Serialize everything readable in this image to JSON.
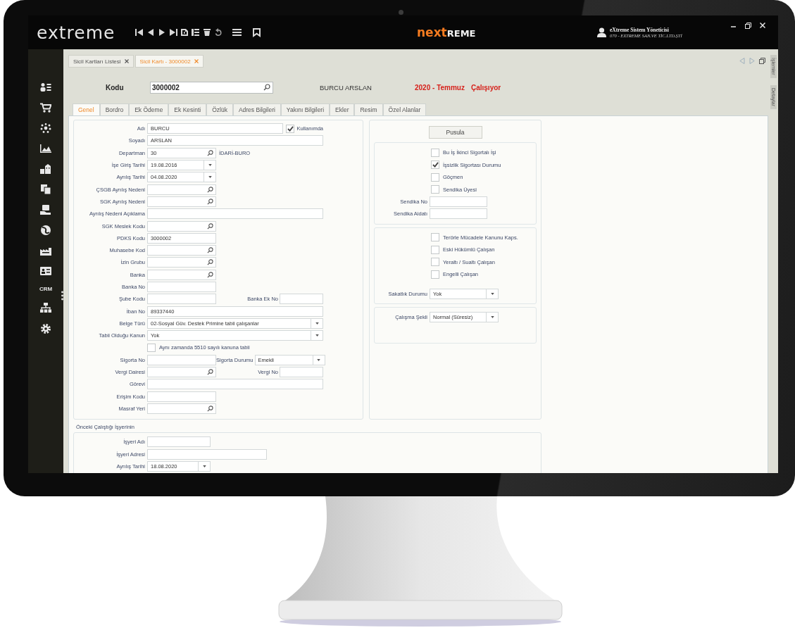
{
  "app_bar": {
    "logo": "extreme",
    "brand": [
      "next",
      "REME"
    ],
    "user": {
      "name": "eXtreme Sistem Yöneticisi",
      "company": "070 - EXTREME SAN.VE TİC.LTD.ŞTİ"
    }
  },
  "sidebar": {
    "crm_label": "CRM"
  },
  "document_tabs": [
    {
      "label": "Sicil Kartları Listesi",
      "selected": false
    },
    {
      "label": "Sicil Kartı - 3000002",
      "selected": true
    }
  ],
  "side_tabs": [
    {
      "label": "İşlemler"
    },
    {
      "label": "Detaylar"
    }
  ],
  "header": {
    "code_label": "Kodu",
    "code_value": "3000002",
    "employee_name": "BURCU ARSLAN",
    "period": "2020 - Temmuz",
    "status": "Çalışıyor"
  },
  "tabs": [
    {
      "label": "Genel",
      "selected": true
    },
    {
      "label": "Bordro",
      "selected": false
    },
    {
      "label": "Ek Ödeme",
      "selected": false
    },
    {
      "label": "Ek Kesinti",
      "selected": false
    },
    {
      "label": "Özlük",
      "selected": false
    },
    {
      "label": "Adres Bilgileri",
      "selected": false
    },
    {
      "label": "Yakını Bilgileri",
      "selected": false
    },
    {
      "label": "Ekler",
      "selected": false
    },
    {
      "label": "Resim",
      "selected": false
    },
    {
      "label": "Özel Alanlar",
      "selected": false
    }
  ],
  "general_form": {
    "rows": [
      {
        "kind": "field",
        "label": "Adı",
        "field": {
          "kind": "text",
          "value": "BURCU",
          "wide": true
        },
        "extra": {
          "kind": "checkbox",
          "label": "Kullanımda",
          "checked": true
        }
      },
      {
        "kind": "field",
        "label": "Soyadı",
        "field": {
          "kind": "text",
          "value": "ARSLAN",
          "wide": true
        }
      },
      {
        "kind": "field",
        "label": "Departman",
        "field": {
          "kind": "lookup",
          "value": "30"
        },
        "extra": {
          "kind": "note",
          "text": "İDARİ-BURO"
        }
      },
      {
        "kind": "field",
        "label": "İşe Giriş Tarihi",
        "field": {
          "kind": "date",
          "value": "19.08.2016"
        }
      },
      {
        "kind": "field",
        "label": "Ayrılış Tarihi",
        "field": {
          "kind": "date",
          "value": "04.08.2020"
        }
      },
      {
        "kind": "field",
        "label": "ÇSGB Ayrılış Nedeni",
        "field": {
          "kind": "lookup"
        }
      },
      {
        "kind": "field",
        "label": "SGK Ayrılış Nedeni",
        "field": {
          "kind": "lookup"
        }
      },
      {
        "kind": "field",
        "label": "Ayrılış Nedeni Açıklama",
        "field": {
          "kind": "text",
          "wide": true
        }
      },
      {
        "kind": "field",
        "label": "SGK Meslek Kodu",
        "field": {
          "kind": "lookup"
        }
      },
      {
        "kind": "field",
        "label": "PDKS Kodu",
        "field": {
          "kind": "text",
          "value": "3000002"
        }
      },
      {
        "kind": "field",
        "label": "Muhasebe Kod",
        "field": {
          "kind": "lookup"
        }
      },
      {
        "kind": "field",
        "label": "İzin Grubu",
        "field": {
          "kind": "lookup"
        }
      },
      {
        "kind": "field",
        "label": "Banka",
        "field": {
          "kind": "lookup"
        }
      },
      {
        "kind": "field",
        "label": "Banka No",
        "field": {
          "kind": "text"
        }
      },
      {
        "kind": "field",
        "label": "Şube Kodu",
        "field": {
          "kind": "text"
        },
        "extra": {
          "kind": "pair",
          "label": "Banka Ek No",
          "field": {
            "kind": "text"
          }
        }
      },
      {
        "kind": "field",
        "label": "İban No",
        "field": {
          "kind": "text",
          "value": "89337440",
          "wide": true
        }
      },
      {
        "kind": "field",
        "label": "Belge Türü",
        "field": {
          "kind": "select",
          "value": "02-Sosyal Güv. Destek Primine tabii çalışanlar",
          "wide": true
        }
      },
      {
        "kind": "field",
        "label": "Tabii Olduğu Kanun",
        "field": {
          "kind": "select",
          "value": "Yok",
          "wide": true
        }
      },
      {
        "kind": "checkbox",
        "label": "Aynı zamanda 5510 sayılı kanuna tabii",
        "checked": false
      },
      {
        "kind": "field",
        "label": "Sigorta No",
        "field": {
          "kind": "text"
        },
        "extra": {
          "kind": "pair",
          "label": "Sigorta Durumu",
          "field": {
            "kind": "select",
            "value": "Emekli"
          }
        }
      },
      {
        "kind": "field",
        "label": "Vergi Dairesi",
        "field": {
          "kind": "lookup"
        },
        "extra": {
          "kind": "pair",
          "label": "Vergi No",
          "field": {
            "kind": "text"
          }
        }
      },
      {
        "kind": "field",
        "label": "Görevi",
        "field": {
          "kind": "text",
          "wide": true
        }
      },
      {
        "kind": "field",
        "label": "Erişim Kodu",
        "field": {
          "kind": "text"
        }
      },
      {
        "kind": "field",
        "label": "Masraf Yeri",
        "field": {
          "kind": "lookup"
        }
      }
    ]
  },
  "right_panel": {
    "button": "Pusula",
    "groups": [
      {
        "rows": [
          {
            "kind": "checkbox",
            "label": "Bu İş İkinci Sigortalı İşi",
            "checked": false
          },
          {
            "kind": "checkbox",
            "label": "İşsizlik Sigortası Durumu",
            "checked": true
          },
          {
            "kind": "checkbox",
            "label": "Göçmen",
            "checked": false
          },
          {
            "kind": "checkbox",
            "label": "Sendika Üyesi",
            "checked": false
          },
          {
            "kind": "field",
            "label": "Sendika No",
            "field": {
              "kind": "text"
            }
          },
          {
            "kind": "field",
            "label": "Sendika Aidatı",
            "field": {
              "kind": "text"
            }
          }
        ]
      },
      {
        "rows": [
          {
            "kind": "checkbox",
            "label": "Terörle Mücadele Kanunu Kaps.",
            "checked": false
          },
          {
            "kind": "checkbox",
            "label": "Eski Hükümlü Çalışan",
            "checked": false
          },
          {
            "kind": "checkbox",
            "label": "Yeraltı / Sualtı Çalışan",
            "checked": false
          },
          {
            "kind": "checkbox",
            "label": "Engelli Çalışan",
            "checked": false
          },
          {
            "kind": "field",
            "label": "Sakatlık Durumu",
            "field": {
              "kind": "select",
              "value": "Yok"
            }
          }
        ]
      },
      {
        "rows": [
          {
            "kind": "field",
            "label": "Çalışma Şekli",
            "field": {
              "kind": "select",
              "value": "Normal (Süresiz)"
            }
          }
        ]
      }
    ]
  },
  "previous_employer": {
    "title": "Önceki Çalıştığı İşyerinin",
    "rows": [
      {
        "kind": "field",
        "label": "İşyeri Adı",
        "field": {
          "kind": "text"
        }
      },
      {
        "kind": "field",
        "label": "İşyeri Adresi",
        "field": {
          "kind": "text",
          "wide": true
        }
      },
      {
        "kind": "field",
        "label": "Ayrılış Tarihi",
        "field": {
          "kind": "date",
          "value": "18.08.2020"
        }
      }
    ]
  }
}
